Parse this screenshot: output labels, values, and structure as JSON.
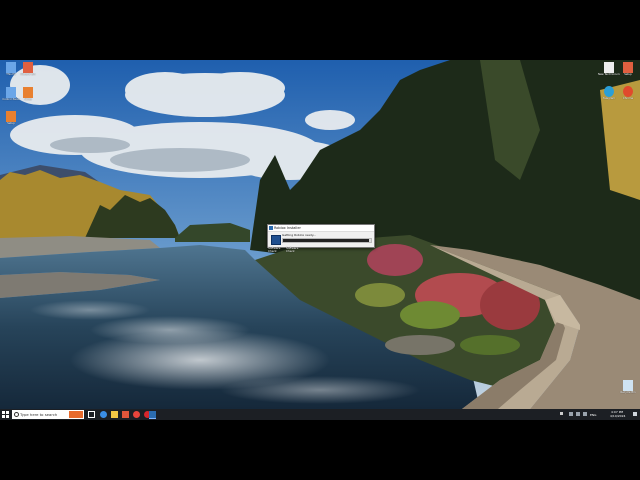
{
  "desktop": {
    "left_icons": [
      {
        "name": "This PC",
        "color": "#6ba6e8"
      },
      {
        "name": "Recycle Bin",
        "color": "#e06040"
      },
      {
        "name": "Control Panel",
        "color": "#6ba6e8"
      },
      {
        "name": "Setup",
        "color": "#e88030"
      },
      {
        "name": "Setup",
        "color": "#e88030"
      }
    ],
    "right_icons": [
      {
        "name": "New Text Document",
        "color": "#eeeeee"
      },
      {
        "name": "Setup",
        "color": "#e06040"
      },
      {
        "name": "Telegram",
        "color": "#2a9fd8"
      },
      {
        "name": "Chrome",
        "color": "#e04a2c"
      }
    ],
    "bottom_right_icon": {
      "name": "Recycle Bin",
      "color": "#cfe3f2"
    }
  },
  "dialog": {
    "title": "Roblox Installer",
    "message": "Getting Roblox ready...",
    "progress": 0.98,
    "drag_labels": [
      "Software Check",
      "Software Check"
    ]
  },
  "taskbar": {
    "search_placeholder": "Type here to search",
    "apps": [
      {
        "name": "task-view",
        "color": "#ffffff"
      },
      {
        "name": "edge",
        "color": "#3a8ee6"
      },
      {
        "name": "file-explorer",
        "color": "#f2c744"
      },
      {
        "name": "store",
        "color": "#e0563b"
      },
      {
        "name": "chrome",
        "color": "#e8453c"
      },
      {
        "name": "opera",
        "color": "#d7262c"
      },
      {
        "name": "roblox-installer",
        "color": "#2b6cb0"
      }
    ],
    "tray": {
      "language": "ENG",
      "time": "4:07 PM",
      "date": "4/10/2024"
    }
  }
}
